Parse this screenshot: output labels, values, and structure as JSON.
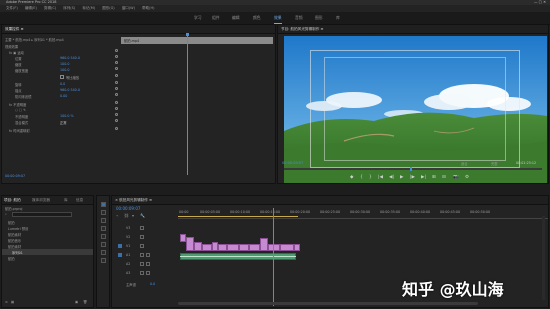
{
  "window": {
    "title": "Adobe Premiere Pro CC 2018",
    "controls": "—  ▢  ✕"
  },
  "menu": [
    "文件(F)",
    "编辑(E)",
    "剪辑(C)",
    "序列(S)",
    "标记(M)",
    "图形(G)",
    "窗口(W)",
    "帮助(H)"
  ],
  "workspaces": [
    "学习",
    "组件",
    "编辑",
    "颜色",
    "效果",
    "音频",
    "图形",
    "库"
  ],
  "active_workspace": "效果",
  "effect_controls": {
    "tabs": [
      "效果控件 ≡",
      "Lumetri 范围",
      "源：(无剪辑)",
      "音频剪辑混合器"
    ],
    "clip": "主要 * 航拍.mp4 ▸ 序列01 * 航拍.mp4",
    "rows": [
      {
        "label": "视频效果",
        "value": ""
      },
      {
        "label": "fx ▣ 运动",
        "value": ""
      },
      {
        "label": "位置",
        "value": "960.0  540.0"
      },
      {
        "label": "缩放",
        "value": "100.0"
      },
      {
        "label": "缩放宽度",
        "value": "100.0"
      },
      {
        "label": "",
        "value": ""
      },
      {
        "label": "旋转",
        "value": "0.0"
      },
      {
        "label": "锚点",
        "value": "960.0  540.0"
      },
      {
        "label": "防闪烁滤镜",
        "value": "0.00"
      },
      {
        "label": "fx 不透明度",
        "value": ""
      },
      {
        "label": "○ □ ✎",
        "value": ""
      },
      {
        "label": "不透明度",
        "value": "100.0 %"
      },
      {
        "label": "混合模式",
        "value": "正常"
      },
      {
        "label": "fx 时间重映射",
        "value": ""
      }
    ],
    "uniform_scale": "等比缩放",
    "clip_label": "航拍.mp4",
    "timecode": "00:00:09:07"
  },
  "program": {
    "title": "节目: 航拍风光剪辑制作 ≡",
    "timecode": "00:00:09:07",
    "fit": "适合",
    "fraction": "完整",
    "duration": "00:01:25:12",
    "transport": [
      "◆",
      "{",
      "}",
      "|◀",
      "◀|",
      "▶",
      "|▶",
      "▶|",
      "⊞",
      "⊟",
      "📷",
      "⚙"
    ]
  },
  "project": {
    "tabs": [
      "项目: 航拍",
      "媒体浏览器",
      "库",
      "信息"
    ],
    "path": "航拍.prproj",
    "search": "",
    "items": [
      "航拍",
      "Lumetri 预设",
      "航拍素材",
      "航拍音乐",
      "航拍素材",
      "序列01",
      "航拍"
    ],
    "selected_index": 5
  },
  "timeline": {
    "title": "× 航拍风光剪辑制作 ≡",
    "timecode": "00:00:09:07",
    "ruler": [
      "00:00",
      "00:00:05:00",
      "00:00:10:00",
      "00:00:15:00",
      "00:00:20:00",
      "00:00:25:00",
      "00:00:30:00",
      "00:00:35:00",
      "00:00:40:00",
      "00:00:45:00",
      "00:00:50:00"
    ],
    "tracks": [
      "V3",
      "V2",
      "V1",
      "A1",
      "A2",
      "A3",
      "主声道"
    ],
    "master_value": "0.0"
  },
  "watermark": "知乎 @玖山海"
}
